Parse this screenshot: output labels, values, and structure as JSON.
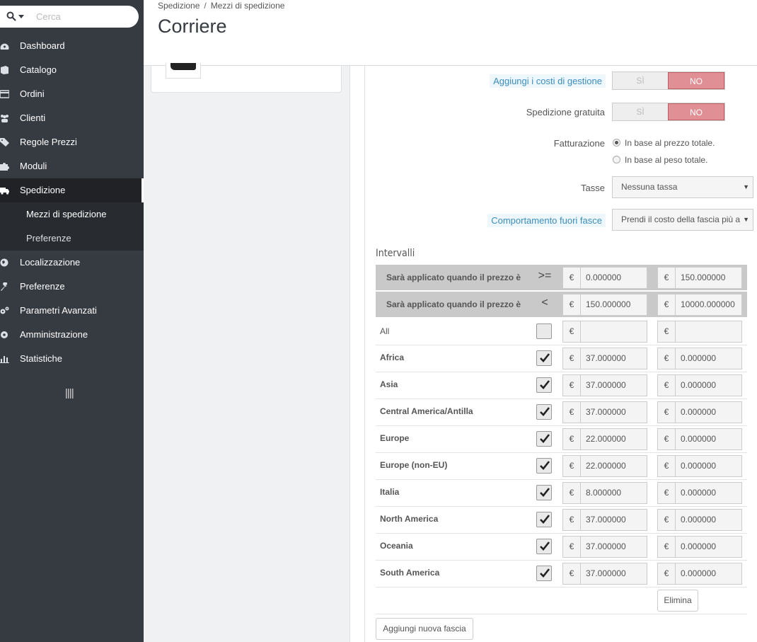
{
  "search": {
    "placeholder": "Cerca"
  },
  "sidebar": {
    "items": [
      {
        "label": "Dashboard",
        "icon": "dashboard-icon"
      },
      {
        "label": "Catalogo",
        "icon": "book-icon"
      },
      {
        "label": "Ordini",
        "icon": "credit-card-icon"
      },
      {
        "label": "Clienti",
        "icon": "users-icon"
      },
      {
        "label": "Regole Prezzi",
        "icon": "tags-icon"
      },
      {
        "label": "Moduli",
        "icon": "puzzle-icon"
      },
      {
        "label": "Spedizione",
        "icon": "truck-icon"
      },
      {
        "label": "Localizzazione",
        "icon": "globe-icon"
      },
      {
        "label": "Preferenze",
        "icon": "wrench-icon"
      },
      {
        "label": "Parametri Avanzati",
        "icon": "cogs-icon"
      },
      {
        "label": "Amministrazione",
        "icon": "gear-icon"
      },
      {
        "label": "Statistiche",
        "icon": "bar-chart-icon"
      }
    ],
    "sub_items": [
      {
        "label": "Mezzi di spedizione"
      },
      {
        "label": "Preferenze"
      }
    ]
  },
  "header": {
    "breadcrumb": [
      "Spedizione",
      "/",
      "Mezzi di spedizione"
    ],
    "title": "Corriere"
  },
  "form": {
    "handling_costs": {
      "label": "Aggiungi i costi di gestione",
      "yes": "SÌ",
      "no": "NO"
    },
    "free_shipping": {
      "label": "Spedizione gratuita",
      "yes": "SÌ",
      "no": "NO"
    },
    "billing": {
      "label": "Fatturazione",
      "options": [
        "In base al prezzo totale.",
        "In base al peso totale."
      ]
    },
    "tax": {
      "label": "Tasse",
      "value": "Nessuna tassa"
    },
    "out_of_range": {
      "label": "Comportamento fuori fasce",
      "value": "Prendi il costo della fascia più alta"
    }
  },
  "ranges": {
    "title": "Intervalli",
    "rows": [
      {
        "label": "Sarà applicato quando il prezzo è",
        "op": ">=",
        "currency": "€",
        "col1": "0.000000",
        "col2": "150.000000"
      },
      {
        "label": "Sarà applicato quando il prezzo è",
        "op": "<",
        "currency": "€",
        "col1": "150.000000",
        "col2": "10000.000000"
      }
    ],
    "zones": [
      {
        "name": "All",
        "checked": false,
        "col1": "",
        "col2": ""
      },
      {
        "name": "Africa",
        "checked": true,
        "col1": "37.000000",
        "col2": "0.000000"
      },
      {
        "name": "Asia",
        "checked": true,
        "col1": "37.000000",
        "col2": "0.000000"
      },
      {
        "name": "Central America/Antilla",
        "checked": true,
        "col1": "37.000000",
        "col2": "0.000000"
      },
      {
        "name": "Europe",
        "checked": true,
        "col1": "22.000000",
        "col2": "0.000000"
      },
      {
        "name": "Europe (non-EU)",
        "checked": true,
        "col1": "22.000000",
        "col2": "0.000000"
      },
      {
        "name": "Italia",
        "checked": true,
        "col1": "8.000000",
        "col2": "0.000000"
      },
      {
        "name": "North America",
        "checked": true,
        "col1": "37.000000",
        "col2": "0.000000"
      },
      {
        "name": "Oceania",
        "checked": true,
        "col1": "37.000000",
        "col2": "0.000000"
      },
      {
        "name": "South America",
        "checked": true,
        "col1": "37.000000",
        "col2": "0.000000"
      }
    ],
    "delete_label": "Elimina",
    "add_range_label": "Aggiungi nuova fascia"
  }
}
